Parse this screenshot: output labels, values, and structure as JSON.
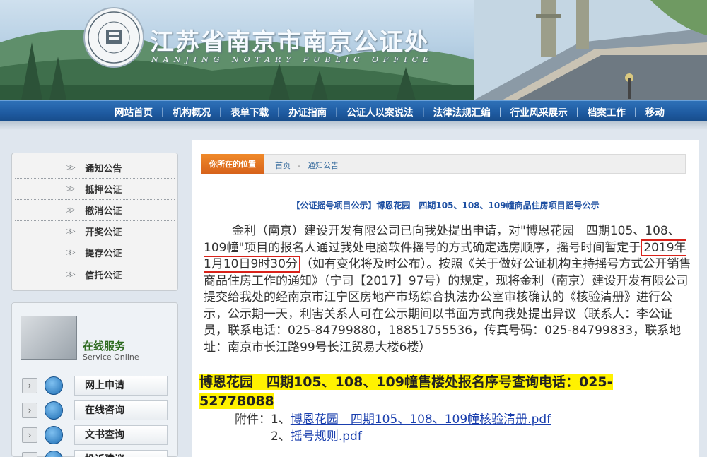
{
  "header": {
    "seal_text": "南京市南京公证处",
    "seal_en": "NANJING NOTARY PUBLIC OFFICE",
    "site_title": "江苏省南京市南京公证处",
    "site_subtitle": "NANJING NOTARY PUBLIC OFFICE"
  },
  "nav": {
    "items": [
      "网站首页",
      "机构概况",
      "表单下载",
      "办证指南",
      "公证人以案说法",
      "法律法规汇编",
      "行业风采展示",
      "档案工作",
      "移动"
    ]
  },
  "sidebar": {
    "items": [
      "通知公告",
      "抵押公证",
      "撤消公证",
      "开奖公证",
      "提存公证",
      "信托公证"
    ],
    "service_title": "在线服务",
    "service_en": "Service Online",
    "services": [
      "网上申请",
      "在线咨询",
      "文书查询",
      "投诉建议"
    ]
  },
  "breadcrumb": {
    "tag": "你所在的位置",
    "home": "首页",
    "sep": "-",
    "current": "通知公告"
  },
  "article": {
    "headline": "【公证摇号项目公示】博恩花园　四期105、108、109幢商品住房项目摇号公示",
    "para_before": "金利（南京）建设开发有限公司已向我处提出申请，对\"博恩花园　四期105、108、109幢\"项目的报名人通过我处电脑软件摇号的方式确定选房顺序，摇号时间暂定于",
    "highlight_time": "2019年1月10日9时30分",
    "para_after": "（如有变化将及时公布）。按照《关于做好公证机构主持摇号方式公开销售商品住房工作的通知》（宁司【2017】97号）的规定，现将金利（南京）建设开发有限公司提交给我处的经南京市江宁区房地产市场综合执法办公室审核确认的《核验清册》进行公示，公示期一天，利害关系人可在公示期间以书面方式向我处提出异议（联系人：李公证员，联系电话：025-84799880，18851755536，传真号码：025-84799833，联系地址：南京市长江路99号长江贸易大楼6楼）",
    "yellow_note": "博恩花园　四期105、108、109幢售楼处报名序号查询电话：025-52778088",
    "attach_label": "附件：",
    "attachments": [
      {
        "index": "1、",
        "name": "博恩花园　四期105、108、109幢核验清册.pdf"
      },
      {
        "index": "2、",
        "name": "摇号规则.pdf"
      }
    ]
  }
}
